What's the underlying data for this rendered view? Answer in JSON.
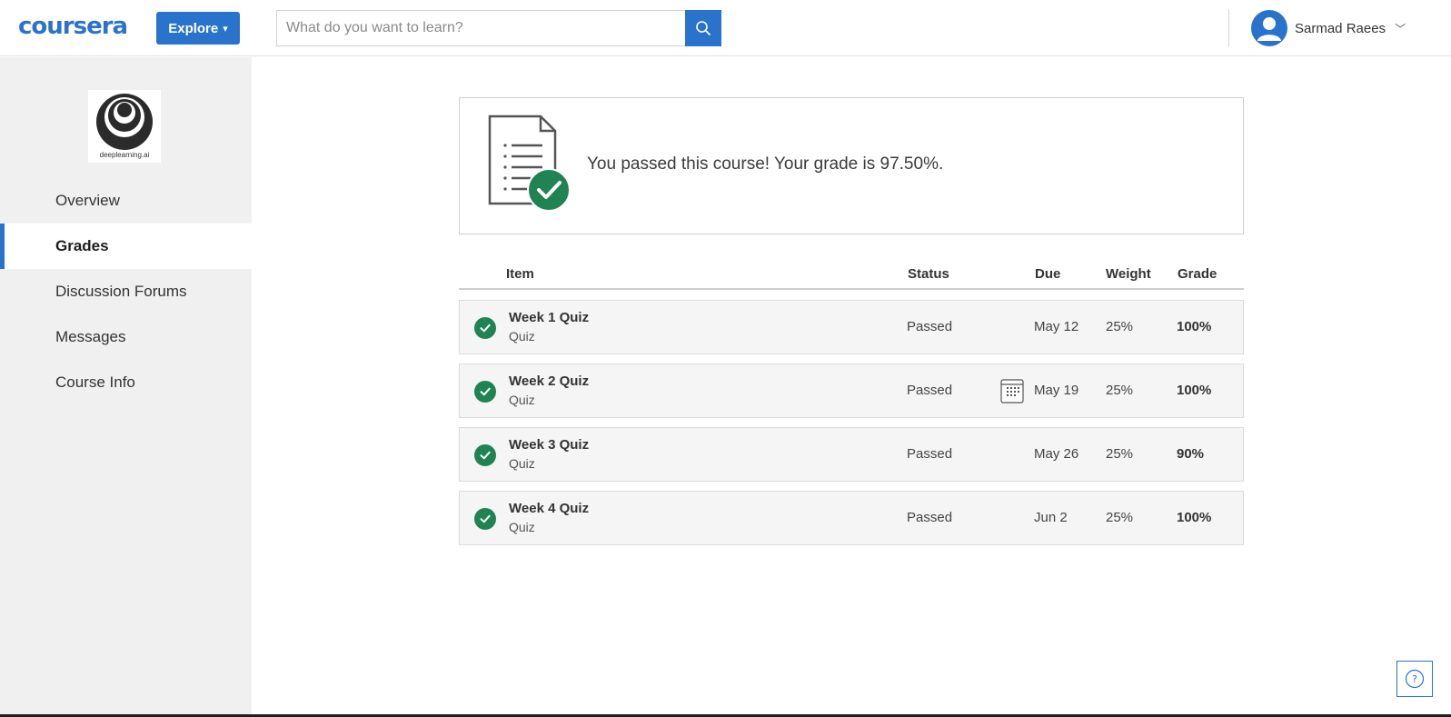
{
  "header": {
    "logo_text": "coursera",
    "explore_label": "Explore",
    "search_placeholder": "What do you want to learn?",
    "user_name": "Sarmad Raees"
  },
  "sidebar": {
    "course_logo_text": "deeplearning.ai",
    "items": [
      {
        "label": "Overview",
        "active": false
      },
      {
        "label": "Grades",
        "active": true
      },
      {
        "label": "Discussion Forums",
        "active": false
      },
      {
        "label": "Messages",
        "active": false
      },
      {
        "label": "Course Info",
        "active": false
      }
    ]
  },
  "banner": {
    "message": "You passed this course! Your grade is 97.50%."
  },
  "table": {
    "headers": {
      "item": "Item",
      "status": "Status",
      "due": "Due",
      "weight": "Weight",
      "grade": "Grade"
    },
    "rows": [
      {
        "title": "Week 1 Quiz",
        "type": "Quiz",
        "status": "Passed",
        "due": "May 12",
        "weight": "25%",
        "grade": "100%",
        "calendar_icon": false
      },
      {
        "title": "Week 2 Quiz",
        "type": "Quiz",
        "status": "Passed",
        "due": "May 19",
        "weight": "25%",
        "grade": "100%",
        "calendar_icon": true
      },
      {
        "title": "Week 3 Quiz",
        "type": "Quiz",
        "status": "Passed",
        "due": "May 26",
        "weight": "25%",
        "grade": "90%",
        "calendar_icon": false
      },
      {
        "title": "Week 4 Quiz",
        "type": "Quiz",
        "status": "Passed",
        "due": "Jun 2",
        "weight": "25%",
        "grade": "100%",
        "calendar_icon": false
      }
    ]
  },
  "colors": {
    "brand_blue": "#2a73cc",
    "success_green": "#1f8354",
    "sidebar_bg": "#f0f0f0"
  },
  "icons": {
    "search": "search-icon",
    "user": "user-icon",
    "check": "check-circle-icon",
    "calendar": "calendar-icon",
    "help": "help-icon",
    "document": "document-check-icon"
  }
}
